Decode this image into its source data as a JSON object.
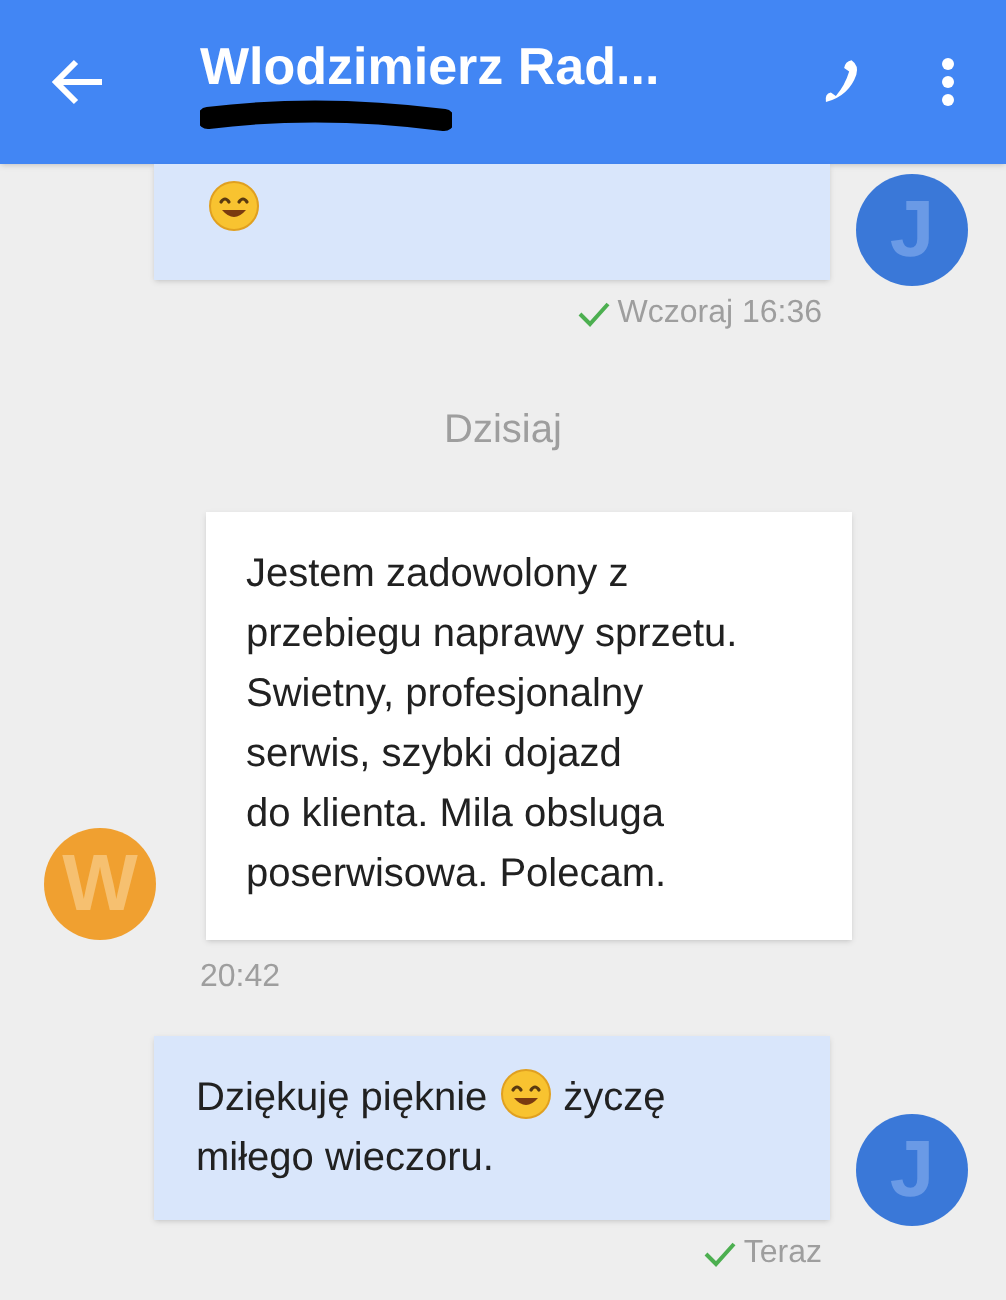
{
  "header": {
    "title": "Wlodzimierz Rad...",
    "subtitle_redacted": true
  },
  "messages": [
    {
      "kind": "outgoing",
      "parts": [
        {
          "kind": "emoji"
        }
      ],
      "avatar": "J",
      "status": "Wczoraj 16:36",
      "delivered": true
    },
    {
      "kind": "divider",
      "text": "Dzisiaj"
    },
    {
      "kind": "incoming",
      "parts": [
        {
          "kind": "text",
          "text": "Jestem zadowolony z\nprzebiegu naprawy sprzetu.\nSwietny, profesjonalny\nserwis, szybki dojazd\ndo klienta. Mila obsluga\nposerwisowa. Polecam."
        }
      ],
      "avatar": "W",
      "status": "20:42",
      "delivered": false
    },
    {
      "kind": "outgoing",
      "parts": [
        {
          "kind": "text",
          "text": "Dziękuję pięknie"
        },
        {
          "kind": "emoji"
        },
        {
          "kind": "text",
          "text": "życzę"
        },
        {
          "kind": "break"
        },
        {
          "kind": "text",
          "text": "miłego wieczoru."
        }
      ],
      "avatar": "J",
      "status": "Teraz",
      "delivered": true
    }
  ]
}
